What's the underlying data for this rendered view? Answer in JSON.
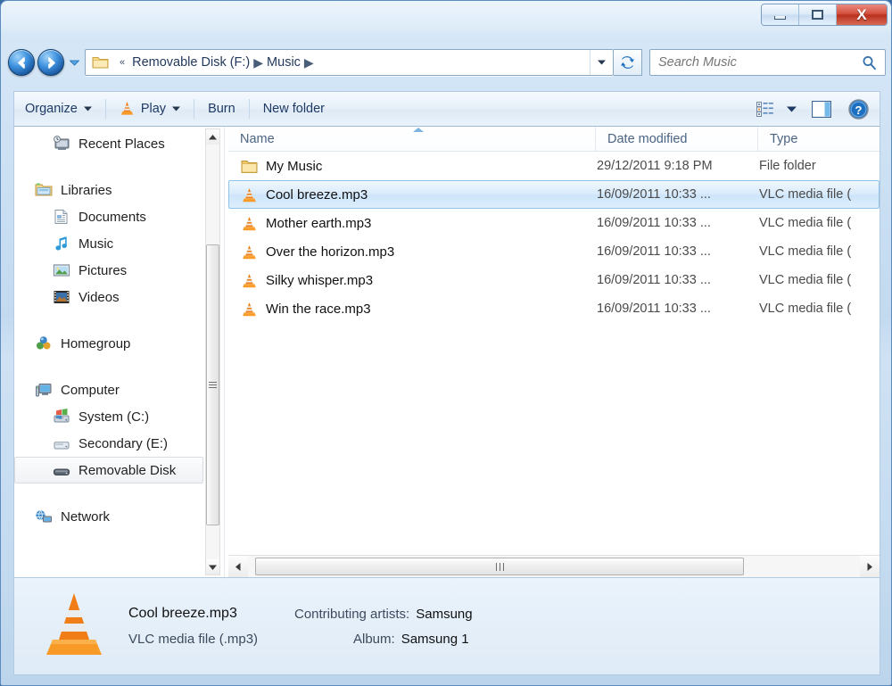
{
  "window": {
    "controls": {
      "minimize": {
        "name": "minimize-button",
        "glyph": "minimize-icon"
      },
      "maximize": {
        "name": "maximize-button",
        "glyph": "maximize-icon"
      },
      "close": {
        "name": "close-button",
        "glyph": "close-icon",
        "label": "X",
        "color": "#c0392b"
      }
    }
  },
  "addressbar": {
    "back_label": "Back",
    "forward_label": "Forward",
    "history_label": "Recent pages",
    "folder_icon": "folder-icon",
    "overflow": "«",
    "crumbs": [
      {
        "label": "Removable Disk (F:)"
      },
      {
        "label": "Music"
      }
    ],
    "dropdown_icon": "chevron-down-icon",
    "refresh_icon": "refresh-icon",
    "refresh_label": "Refresh"
  },
  "search": {
    "placeholder": "Search Music",
    "value": "",
    "icon": "search-icon"
  },
  "toolbar": {
    "organize_label": "Organize",
    "play_label": "Play",
    "play_icon": "vlc-cone-icon",
    "burn_label": "Burn",
    "new_folder_label": "New folder",
    "change_view_icon": "change-view-icon",
    "preview_pane_icon": "preview-pane-icon",
    "help_icon": "help-icon"
  },
  "navpane": {
    "items": [
      {
        "label": "Recent Places",
        "icon": "recent-places-icon",
        "indent": 2,
        "selected": false
      },
      {
        "label": "",
        "icon": "gap",
        "indent": 0,
        "selected": false
      },
      {
        "label": "Libraries",
        "icon": "libraries-icon",
        "indent": 1,
        "selected": false
      },
      {
        "label": "Documents",
        "icon": "documents-icon",
        "indent": 2,
        "selected": false
      },
      {
        "label": "Music",
        "icon": "music-icon",
        "indent": 2,
        "selected": false
      },
      {
        "label": "Pictures",
        "icon": "pictures-icon",
        "indent": 2,
        "selected": false
      },
      {
        "label": "Videos",
        "icon": "videos-icon",
        "indent": 2,
        "selected": false
      },
      {
        "label": "",
        "icon": "gap",
        "indent": 0,
        "selected": false
      },
      {
        "label": "Homegroup",
        "icon": "homegroup-icon",
        "indent": 1,
        "selected": false
      },
      {
        "label": "",
        "icon": "gap",
        "indent": 0,
        "selected": false
      },
      {
        "label": "Computer",
        "icon": "computer-icon",
        "indent": 1,
        "selected": false
      },
      {
        "label": "System (C:)",
        "icon": "system-drive-icon",
        "indent": 2,
        "selected": false
      },
      {
        "label": "Secondary (E:)",
        "icon": "drive-icon",
        "indent": 2,
        "selected": false
      },
      {
        "label": "Removable Disk",
        "icon": "removable-disk-icon",
        "indent": 2,
        "selected": true
      },
      {
        "label": "",
        "icon": "gap",
        "indent": 0,
        "selected": false
      },
      {
        "label": "Network",
        "icon": "network-icon",
        "indent": 1,
        "selected": false
      }
    ],
    "scrollbar": {
      "up_icon": "scroll-up-icon",
      "down_icon": "scroll-down-icon"
    }
  },
  "filelist": {
    "columns": [
      {
        "label": "Name",
        "key": "name",
        "sorted": true,
        "sort_direction": "ascending"
      },
      {
        "label": "Date modified",
        "key": "date",
        "sorted": false
      },
      {
        "label": "Type",
        "key": "type",
        "sorted": false
      }
    ],
    "rows": [
      {
        "name": "My Music",
        "date": "29/12/2011 9:18 PM",
        "type": "File folder",
        "icon": "folder-icon",
        "selected": false
      },
      {
        "name": "Cool breeze.mp3",
        "date": "16/09/2011 10:33 ...",
        "type": "VLC media file (",
        "icon": "vlc-cone-icon",
        "selected": true
      },
      {
        "name": "Mother earth.mp3",
        "date": "16/09/2011 10:33 ...",
        "type": "VLC media file (",
        "icon": "vlc-cone-icon",
        "selected": false
      },
      {
        "name": "Over the horizon.mp3",
        "date": "16/09/2011 10:33 ...",
        "type": "VLC media file (",
        "icon": "vlc-cone-icon",
        "selected": false
      },
      {
        "name": "Silky whisper.mp3",
        "date": "16/09/2011 10:33 ...",
        "type": "VLC media file (",
        "icon": "vlc-cone-icon",
        "selected": false
      },
      {
        "name": "Win the race.mp3",
        "date": "16/09/2011 10:33 ...",
        "type": "VLC media file (",
        "icon": "vlc-cone-icon",
        "selected": false
      }
    ],
    "hscroll": {
      "left_icon": "scroll-left-icon",
      "right_icon": "scroll-right-icon"
    }
  },
  "details": {
    "icon": "vlc-cone-icon",
    "filename": "Cool breeze.mp3",
    "filetype": "VLC media file (.mp3)",
    "artists_label": "Contributing artists:",
    "artists_value": "Samsung",
    "album_label": "Album:",
    "album_value": "Samsung 1"
  },
  "colors": {
    "accent": "#2b6cb0",
    "selection": "#cde4fa",
    "selection_border": "#8fc2ea",
    "close_red": "#c0392b",
    "vlc_orange": "#f08b11",
    "chrome_blue": "#bdd7ee"
  }
}
